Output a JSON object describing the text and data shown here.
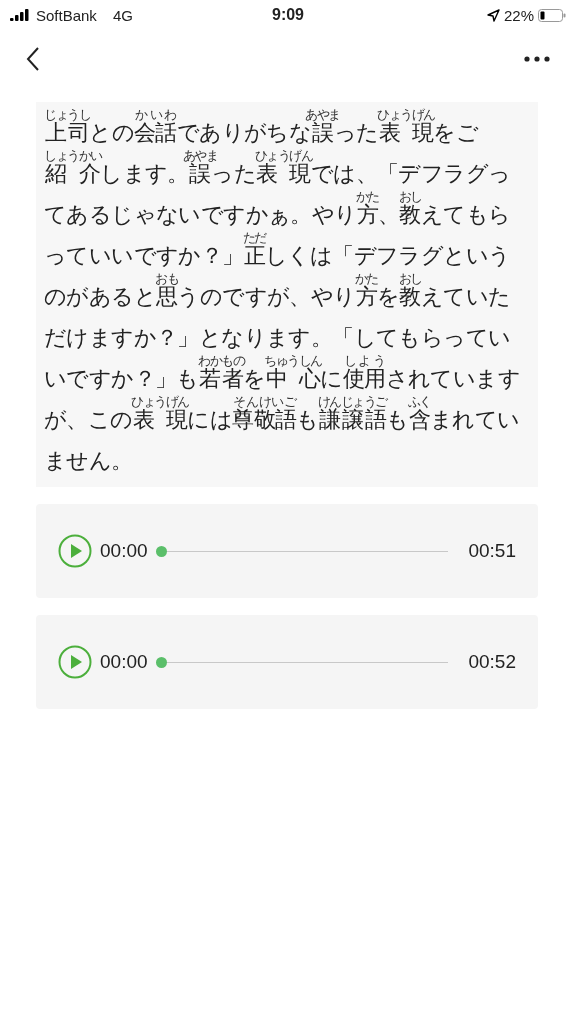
{
  "status_bar": {
    "carrier": "SoftBank",
    "network": "4G",
    "time": "9:09",
    "battery": "22%"
  },
  "article": {
    "segments": [
      {
        "text": "上司",
        "ruby": "じょうし"
      },
      {
        "text": "との"
      },
      {
        "text": "会話",
        "ruby": "かいわ"
      },
      {
        "text": "でありがちな"
      },
      {
        "text": "誤",
        "ruby": "あやま"
      },
      {
        "text": "った"
      },
      {
        "text": "表 現",
        "ruby": "ひょうげん"
      },
      {
        "text": "をご"
      },
      {
        "text": "紹 介",
        "ruby": "しょうかい"
      },
      {
        "text": "します。"
      },
      {
        "text": "誤",
        "ruby": "あやま"
      },
      {
        "text": "った"
      },
      {
        "text": "表 現",
        "ruby": "ひょうげん"
      },
      {
        "text": "では、「デフラグってあるじゃないですかぁ。やり"
      },
      {
        "text": "方",
        "ruby": "かた"
      },
      {
        "text": "、"
      },
      {
        "text": "教",
        "ruby": "おし"
      },
      {
        "text": "えてもらっていいですか？」"
      },
      {
        "text": "正",
        "ruby": "ただ"
      },
      {
        "text": "しくは「デフラグというのがあると"
      },
      {
        "text": "思",
        "ruby": "おも"
      },
      {
        "text": "うのですが、やり"
      },
      {
        "text": "方",
        "ruby": "かた"
      },
      {
        "text": "を"
      },
      {
        "text": "教",
        "ruby": "おし"
      },
      {
        "text": "えていただけますか？」となります。「してもらっていいですか？」も"
      },
      {
        "text": "若者",
        "ruby": "わかもの"
      },
      {
        "text": "を"
      },
      {
        "text": "中 心",
        "ruby": "ちゅうしん"
      },
      {
        "text": "に"
      },
      {
        "text": "使用",
        "ruby": "しよう"
      },
      {
        "text": "されていますが、この"
      },
      {
        "text": "表 現",
        "ruby": "ひょうげん"
      },
      {
        "text": "には"
      },
      {
        "text": "尊敬語",
        "ruby": "そんけいご"
      },
      {
        "text": "も"
      },
      {
        "text": "謙譲語",
        "ruby": "けんじょうご"
      },
      {
        "text": "も"
      },
      {
        "text": "含",
        "ruby": "ふく"
      },
      {
        "text": "まれていません。"
      }
    ]
  },
  "audio": [
    {
      "current": "00:00",
      "duration": "00:51",
      "level": 0
    },
    {
      "current": "00:00",
      "duration": "00:52",
      "level": 0
    }
  ]
}
